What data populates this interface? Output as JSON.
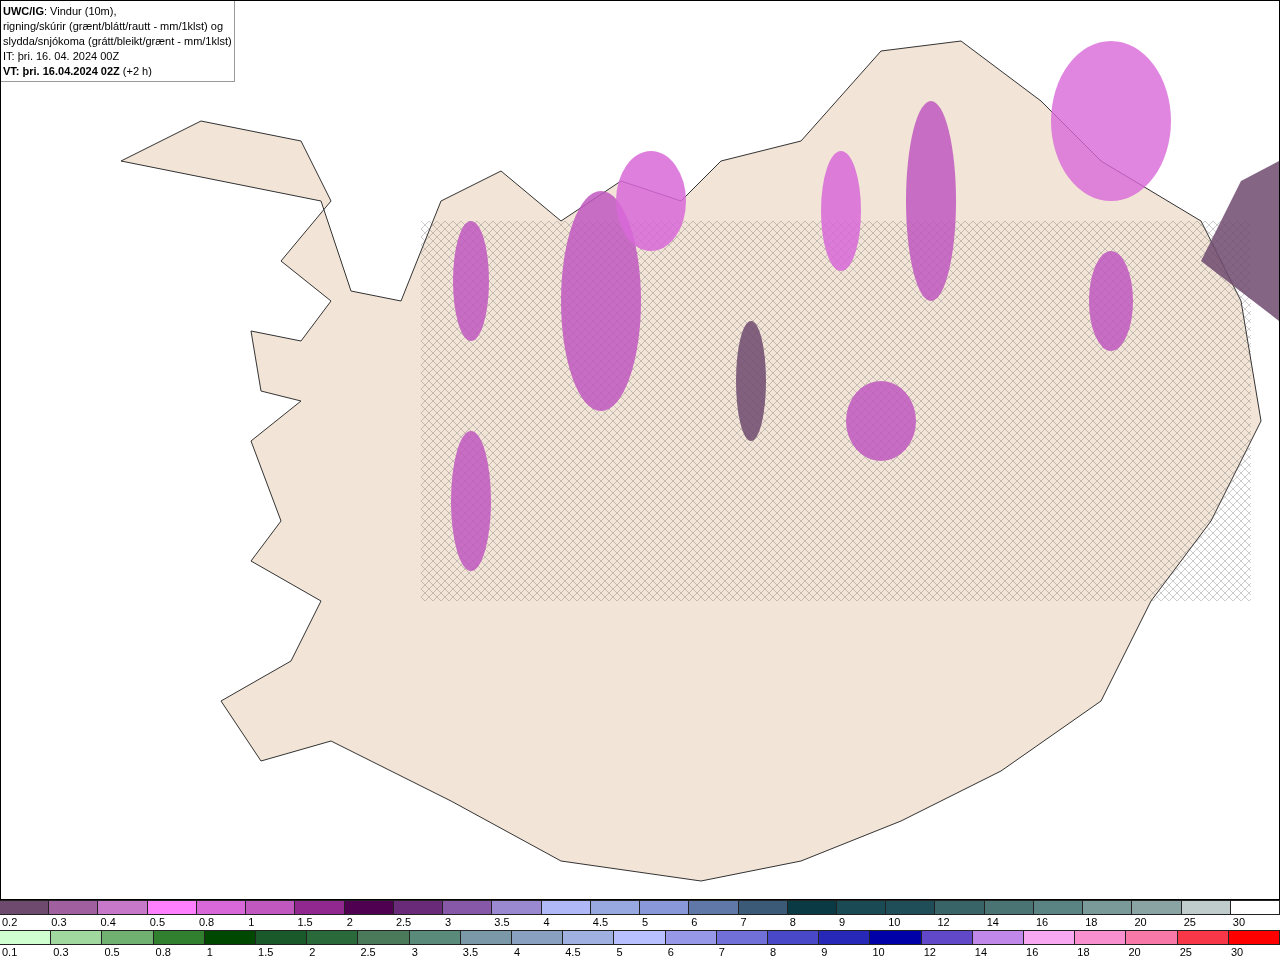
{
  "header": {
    "lines": [
      "**UWC/IG**: Vindur (10m),",
      "rigning/skúrir (grænt/blátt/rautt - mm/1klst) og",
      "slydda/snjókoma (grátt/bleikt/grænt - mm/1klst)",
      "IT: þri. 16. 04. 2024 00Z",
      "**VT: þri. 16.04.2024 02Z** (+2 h)"
    ]
  },
  "map": {
    "kind": "forecast-map"
  },
  "legends": [
    {
      "items": [
        {
          "label": "0.2",
          "color": "#6e4a6e"
        },
        {
          "label": "0.3",
          "color": "#a060a0"
        },
        {
          "label": "0.4",
          "color": "#c878c8"
        },
        {
          "label": "0.5",
          "color": "#ff80ff"
        },
        {
          "label": "0.8",
          "color": "#d868d8"
        },
        {
          "label": "1",
          "color": "#c058c0"
        },
        {
          "label": "1.5",
          "color": "#902890"
        },
        {
          "label": "2",
          "color": "#500050"
        },
        {
          "label": "2.5",
          "color": "#6a2a7a"
        },
        {
          "label": "3",
          "color": "#8858a8"
        },
        {
          "label": "3.5",
          "color": "#9a88d0"
        },
        {
          "label": "4",
          "color": "#b0b8f8"
        },
        {
          "label": "4.5",
          "color": "#98a8e0"
        },
        {
          "label": "5",
          "color": "#8898d8"
        },
        {
          "label": "6",
          "color": "#6078a8"
        },
        {
          "label": "7",
          "color": "#3a5a78"
        },
        {
          "label": "8",
          "color": "#0a3a44"
        },
        {
          "label": "9",
          "color": "#1a4a54"
        },
        {
          "label": "10",
          "color": "#204e58"
        },
        {
          "label": "12",
          "color": "#386468"
        },
        {
          "label": "14",
          "color": "#4a7474"
        },
        {
          "label": "16",
          "color": "#5a8484"
        },
        {
          "label": "18",
          "color": "#7a9a9a"
        },
        {
          "label": "20",
          "color": "#8aa4a4"
        },
        {
          "label": "25",
          "color": "#c0cccc"
        },
        {
          "label": "30",
          "color": "#ffffff"
        }
      ]
    },
    {
      "items": [
        {
          "label": "0.1",
          "color": "#d0ffd0"
        },
        {
          "label": "0.3",
          "color": "#a0d8a0"
        },
        {
          "label": "0.5",
          "color": "#70b070"
        },
        {
          "label": "0.8",
          "color": "#308030"
        },
        {
          "label": "1",
          "color": "#004800"
        },
        {
          "label": "1.5",
          "color": "#1a5a2a"
        },
        {
          "label": "2",
          "color": "#2a6a3a"
        },
        {
          "label": "2.5",
          "color": "#4a7a5a"
        },
        {
          "label": "3",
          "color": "#5a8a7a"
        },
        {
          "label": "3.5",
          "color": "#7a98a8"
        },
        {
          "label": "4",
          "color": "#8aa0c0"
        },
        {
          "label": "4.5",
          "color": "#a0b0e0"
        },
        {
          "label": "5",
          "color": "#b8c0ff"
        },
        {
          "label": "6",
          "color": "#9898e8"
        },
        {
          "label": "7",
          "color": "#7070d8"
        },
        {
          "label": "8",
          "color": "#4848c8"
        },
        {
          "label": "9",
          "color": "#2828b8"
        },
        {
          "label": "10",
          "color": "#0000a8"
        },
        {
          "label": "12",
          "color": "#6048c8"
        },
        {
          "label": "14",
          "color": "#c088e8"
        },
        {
          "label": "16",
          "color": "#f8a8f0"
        },
        {
          "label": "18",
          "color": "#f890d0"
        },
        {
          "label": "20",
          "color": "#f878a8"
        },
        {
          "label": "25",
          "color": "#f83848"
        },
        {
          "label": "30",
          "color": "#ff0000"
        }
      ]
    }
  ]
}
